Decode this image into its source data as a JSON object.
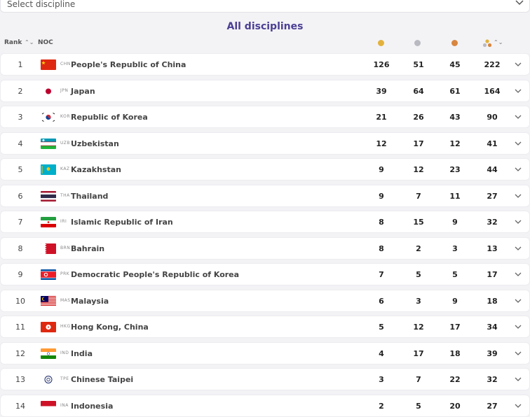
{
  "discipline_select": {
    "placeholder": "Select discipline"
  },
  "title": "All disciplines",
  "header": {
    "rank": "Rank",
    "sort_icon": "⌃⌄",
    "noc": "NOC"
  },
  "colors": {
    "gold": "#e3b23c",
    "silver": "#b9b9c2",
    "bronze": "#d88640",
    "title": "#4b3f94"
  },
  "rows": [
    {
      "rank": "1",
      "code": "CHN",
      "name": "People's Republic of China",
      "gold": "126",
      "silver": "51",
      "bronze": "45",
      "total": "222"
    },
    {
      "rank": "2",
      "code": "JPN",
      "name": "Japan",
      "gold": "39",
      "silver": "64",
      "bronze": "61",
      "total": "164"
    },
    {
      "rank": "3",
      "code": "KOR",
      "name": "Republic of Korea",
      "gold": "21",
      "silver": "26",
      "bronze": "43",
      "total": "90"
    },
    {
      "rank": "4",
      "code": "UZB",
      "name": "Uzbekistan",
      "gold": "12",
      "silver": "17",
      "bronze": "12",
      "total": "41"
    },
    {
      "rank": "5",
      "code": "KAZ",
      "name": "Kazakhstan",
      "gold": "9",
      "silver": "12",
      "bronze": "23",
      "total": "44"
    },
    {
      "rank": "6",
      "code": "THA",
      "name": "Thailand",
      "gold": "9",
      "silver": "7",
      "bronze": "11",
      "total": "27"
    },
    {
      "rank": "7",
      "code": "IRI",
      "name": "Islamic Republic of Iran",
      "gold": "8",
      "silver": "15",
      "bronze": "9",
      "total": "32"
    },
    {
      "rank": "8",
      "code": "BRN",
      "name": "Bahrain",
      "gold": "8",
      "silver": "2",
      "bronze": "3",
      "total": "13"
    },
    {
      "rank": "9",
      "code": "PRK",
      "name": "Democratic People's Republic of Korea",
      "gold": "7",
      "silver": "5",
      "bronze": "5",
      "total": "17"
    },
    {
      "rank": "10",
      "code": "MAS",
      "name": "Malaysia",
      "gold": "6",
      "silver": "3",
      "bronze": "9",
      "total": "18"
    },
    {
      "rank": "11",
      "code": "HKG",
      "name": "Hong Kong, China",
      "gold": "5",
      "silver": "12",
      "bronze": "17",
      "total": "34"
    },
    {
      "rank": "12",
      "code": "IND",
      "name": "India",
      "gold": "4",
      "silver": "17",
      "bronze": "18",
      "total": "39"
    },
    {
      "rank": "13",
      "code": "TPE",
      "name": "Chinese Taipei",
      "gold": "3",
      "silver": "7",
      "bronze": "22",
      "total": "32"
    },
    {
      "rank": "14",
      "code": "INA",
      "name": "Indonesia",
      "gold": "2",
      "silver": "5",
      "bronze": "20",
      "total": "27"
    }
  ]
}
